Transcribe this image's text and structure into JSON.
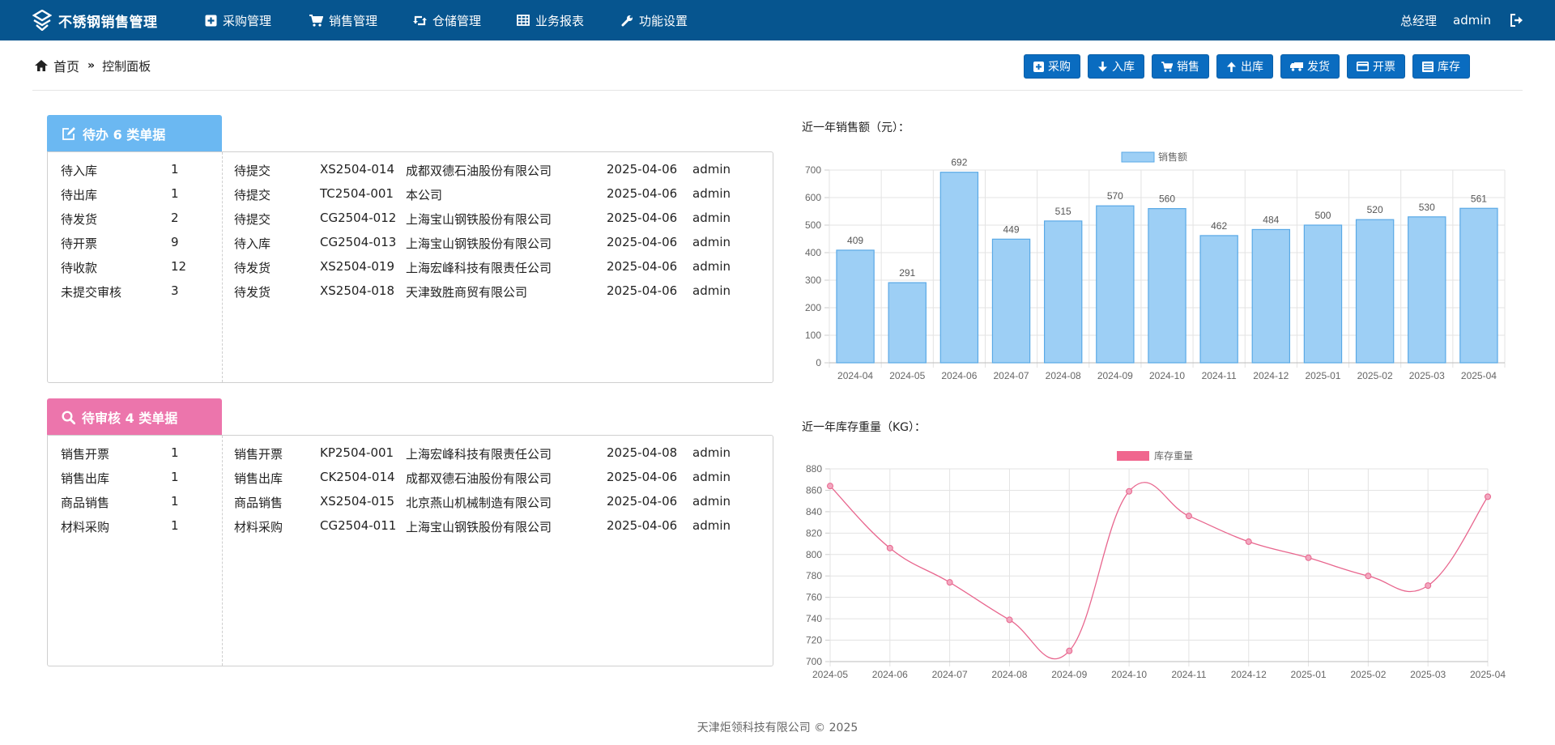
{
  "app": {
    "title": "不锈钢销售管理",
    "nav": [
      {
        "label": "采购管理",
        "icon": "plus-square-icon"
      },
      {
        "label": "销售管理",
        "icon": "cart-icon"
      },
      {
        "label": "仓储管理",
        "icon": "retweet-icon"
      },
      {
        "label": "业务报表",
        "icon": "table-icon"
      },
      {
        "label": "功能设置",
        "icon": "wrench-icon"
      }
    ],
    "user_role": "总经理",
    "user_name": "admin"
  },
  "breadcrumb": {
    "home": "首页",
    "current": "控制面板"
  },
  "toolbar": [
    {
      "label": "采购",
      "icon": "plus-square-icon"
    },
    {
      "label": "入库",
      "icon": "arrow-down-icon"
    },
    {
      "label": "销售",
      "icon": "cart-icon"
    },
    {
      "label": "出库",
      "icon": "arrow-up-icon"
    },
    {
      "label": "发货",
      "icon": "truck-icon"
    },
    {
      "label": "开票",
      "icon": "credit-card-icon"
    },
    {
      "label": "库存",
      "icon": "list-icon"
    }
  ],
  "pending": {
    "title": "待办 6 类单据",
    "color": "#6bb8f2",
    "categories": [
      {
        "name": "待入库",
        "count": "1"
      },
      {
        "name": "待出库",
        "count": "1"
      },
      {
        "name": "待发货",
        "count": "2"
      },
      {
        "name": "待开票",
        "count": "9"
      },
      {
        "name": "待收款",
        "count": "12"
      },
      {
        "name": "未提交审核",
        "count": "3"
      }
    ],
    "items": [
      {
        "status": "待提交",
        "code": "XS2504-014",
        "company": "成都双德石油股份有限公司",
        "date": "2025-04-06",
        "user": "admin"
      },
      {
        "status": "待提交",
        "code": "TC2504-001",
        "company": "本公司",
        "date": "2025-04-06",
        "user": "admin"
      },
      {
        "status": "待提交",
        "code": "CG2504-012",
        "company": "上海宝山钢铁股份有限公司",
        "date": "2025-04-06",
        "user": "admin"
      },
      {
        "status": "待入库",
        "code": "CG2504-013",
        "company": "上海宝山钢铁股份有限公司",
        "date": "2025-04-06",
        "user": "admin"
      },
      {
        "status": "待发货",
        "code": "XS2504-019",
        "company": "上海宏峰科技有限责任公司",
        "date": "2025-04-06",
        "user": "admin"
      },
      {
        "status": "待发货",
        "code": "XS2504-018",
        "company": "天津致胜商贸有限公司",
        "date": "2025-04-06",
        "user": "admin"
      }
    ]
  },
  "review": {
    "title": "待审核 4 类单据",
    "color": "#ec75ac",
    "categories": [
      {
        "name": "销售开票",
        "count": "1"
      },
      {
        "name": "销售出库",
        "count": "1"
      },
      {
        "name": "商品销售",
        "count": "1"
      },
      {
        "name": "材料采购",
        "count": "1"
      }
    ],
    "items": [
      {
        "status": "销售开票",
        "code": "KP2504-001",
        "company": "上海宏峰科技有限责任公司",
        "date": "2025-04-08",
        "user": "admin"
      },
      {
        "status": "销售出库",
        "code": "CK2504-014",
        "company": "成都双德石油股份有限公司",
        "date": "2025-04-06",
        "user": "admin"
      },
      {
        "status": "商品销售",
        "code": "XS2504-015",
        "company": "北京燕山机械制造有限公司",
        "date": "2025-04-06",
        "user": "admin"
      },
      {
        "status": "材料采购",
        "code": "CG2504-011",
        "company": "上海宝山钢铁股份有限公司",
        "date": "2025-04-06",
        "user": "admin"
      }
    ]
  },
  "chart_data": [
    {
      "type": "bar",
      "title": "近一年销售额（元）：",
      "categories": [
        "2024-04",
        "2024-05",
        "2024-06",
        "2024-07",
        "2024-08",
        "2024-09",
        "2024-10",
        "2024-11",
        "2024-12",
        "2025-01",
        "2025-02",
        "2025-03",
        "2025-04"
      ],
      "series": [
        {
          "name": "销售额",
          "values": [
            409,
            291,
            692,
            449,
            515,
            570,
            560,
            462,
            484,
            500,
            520,
            530,
            561
          ]
        }
      ],
      "ylim": [
        0,
        700
      ],
      "yticks": [
        "0",
        "100",
        "200",
        "300",
        "400",
        "500",
        "600",
        "700"
      ],
      "grid": true,
      "legend": "top-center",
      "data_labels": true,
      "fill_color": "#9dcff5",
      "stroke_color": "#5aa9e6"
    },
    {
      "type": "line",
      "title": "近一年库存重量（KG）：",
      "categories": [
        "2024-05",
        "2024-06",
        "2024-07",
        "2024-08",
        "2024-09",
        "2024-10",
        "2024-11",
        "2024-12",
        "2025-01",
        "2025-02",
        "2025-03",
        "2025-04"
      ],
      "series": [
        {
          "name": "库存重量",
          "values": [
            864,
            806,
            774,
            739,
            710,
            859,
            836,
            812,
            797,
            780,
            771,
            854
          ]
        }
      ],
      "ylim": [
        700,
        880
      ],
      "yticks": [
        "700",
        "720",
        "740",
        "760",
        "780",
        "800",
        "820",
        "840",
        "860",
        "880"
      ],
      "grid": true,
      "legend": "top-center",
      "smooth": true,
      "line_color": "#e8668e",
      "legend_color": "#f0668e"
    }
  ],
  "footer": "天津炬领科技有限公司 © 2025"
}
